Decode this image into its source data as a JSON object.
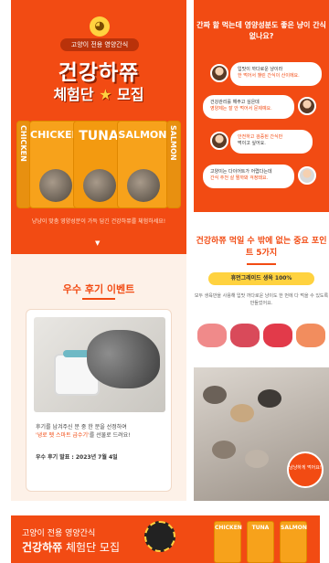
{
  "hero": {
    "pill": "고양이 전용 영양간식",
    "title_line1": "건강하쮸",
    "title_line2_prefix": "체험단",
    "title_line2_suffix": "모집",
    "star_icon": "★",
    "packs": [
      "CHICKEN",
      "CHICKEN",
      "TUNA",
      "SALMON",
      "SALMON"
    ],
    "subtitle": "냥냥이 맞춤 영양성분이 가득 담긴 건강하쮸를 체험하세요!",
    "arrow": "▼"
  },
  "review": {
    "title": "우수 후기 이벤트",
    "text_prefix": "후기를 남겨주신 분 중 한 분을 선정하여",
    "text_highlight": "'냉로 펫 스마트 급수기'",
    "text_suffix": "를 선물로 드려요!",
    "date": "우수 후기 발표 : 2023년 7월 4일"
  },
  "chat": {
    "title": "간짜 할 먹는데 영양성분도 좋은 냥이 간식 없나요?",
    "bubbles": [
      {
        "text": "입맛이 까다로운 냥이라",
        "highlight": "한 먹어서 챌린 간식이 산이에요."
      },
      {
        "text": "건강관리를 해주고 싶은데",
        "highlight": "영양제는 잘 안 먹어서 문제예요."
      },
      {
        "text": "안전하고 검증된 간식만",
        "highlight": "먹이고 싶어요."
      },
      {
        "text": "고양이는 다이어트가 어렵다는데",
        "highlight": "간식 추천 살 찔까봐 걱정돼요."
      }
    ]
  },
  "points": {
    "title": "건강하쮸 먹일 수 밖에 없는 중요 포인트 5가지",
    "grade": "휴먼그레이드 생육 100%",
    "desc": "모두 생육만을 사용해 입맛 까다로운 냥이도 한 번에 다 먹을 수 있도록 만들었어요.",
    "badge": "냥냥하게 먹어요!"
  },
  "banner": {
    "sub": "고양이 전용 영양간식",
    "title_bold": "건강하쮸",
    "title_light": " 체험단 모집",
    "packs": [
      "CHICKEN",
      "TUNA",
      "SALMON"
    ]
  }
}
